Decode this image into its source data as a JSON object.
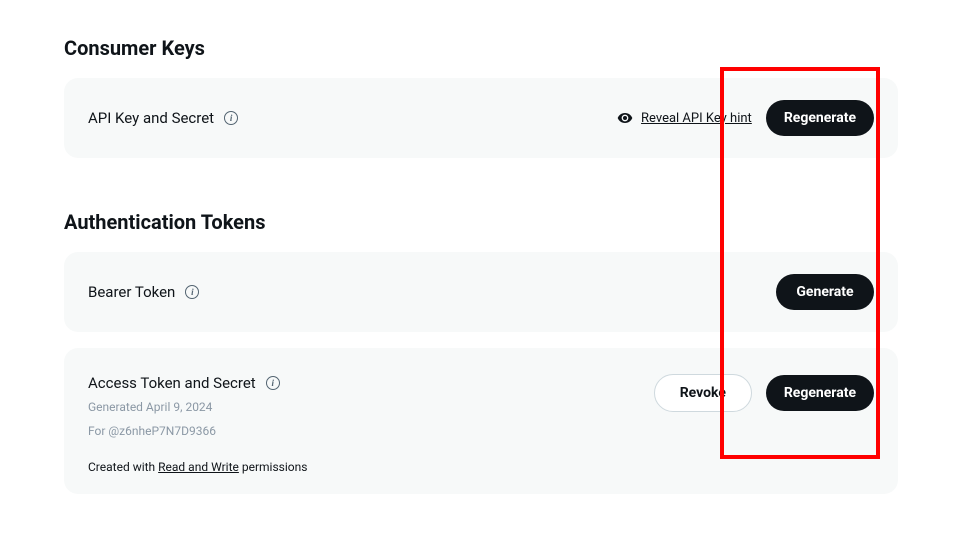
{
  "consumer_keys": {
    "title": "Consumer Keys",
    "api_key": {
      "label": "API Key and Secret",
      "reveal_label": "Reveal API Key hint",
      "regenerate_label": "Regenerate"
    }
  },
  "auth_tokens": {
    "title": "Authentication Tokens",
    "bearer": {
      "label": "Bearer Token",
      "generate_label": "Generate"
    },
    "access_token": {
      "label": "Access Token and Secret",
      "generated_text": "Generated April 9, 2024",
      "for_text": "For @z6nheP7N7D9366",
      "permissions_prefix": "Created with ",
      "permissions_link": "Read and Write",
      "permissions_suffix": " permissions",
      "revoke_label": "Revoke",
      "regenerate_label": "Regenerate"
    }
  }
}
